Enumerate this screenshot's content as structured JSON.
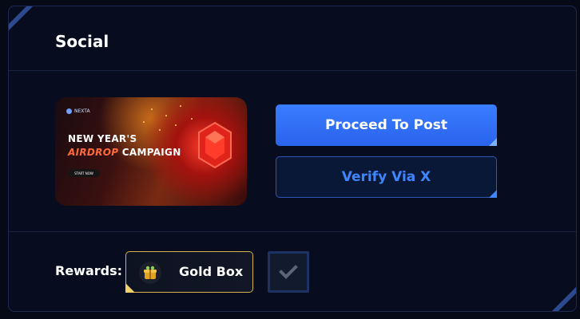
{
  "card": {
    "title": "Social"
  },
  "banner": {
    "brand": "NEXTA",
    "headline_line1": "NEW YEAR'S",
    "headline_accent": "AIRDROP",
    "headline_line2_rest": " CAMPAIGN",
    "cta": "START NOW"
  },
  "actions": {
    "proceed_label": "Proceed To Post",
    "verify_label": "Verify Via X"
  },
  "rewards": {
    "label": "Rewards:",
    "item_name": "Gold Box",
    "item_icon": "gold-box-icon",
    "checked": false
  },
  "colors": {
    "primary": "#2f6ff5",
    "accent_gold": "#d4b24c",
    "background": "#070d1e"
  }
}
